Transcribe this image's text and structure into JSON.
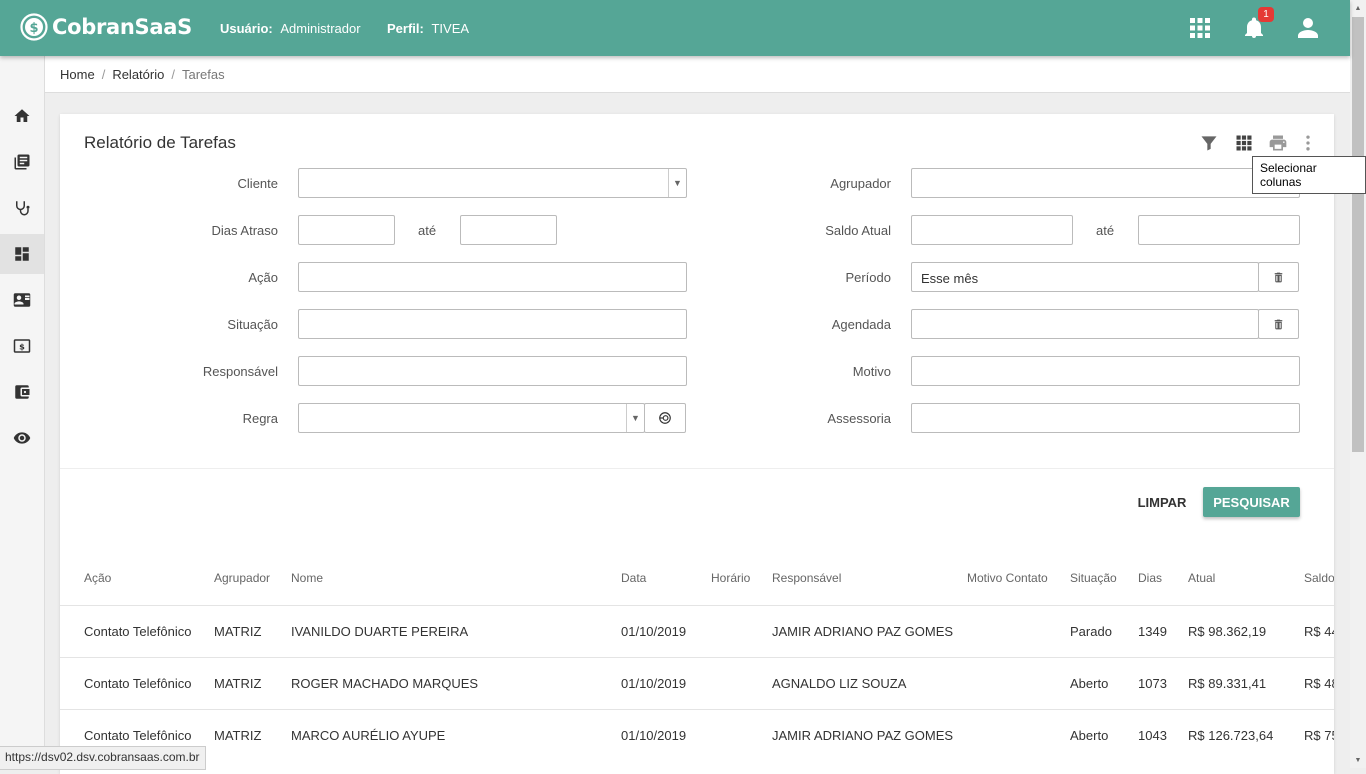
{
  "app": {
    "name": "CobranSaaS",
    "user_label": "Usuário:",
    "user_value": "Administrador",
    "profile_label": "Perfil:",
    "profile_value": "TIVEA",
    "notification_count": "1",
    "accent_color": "#55a696"
  },
  "sidebar": {
    "items": [
      {
        "icon": "home-icon"
      },
      {
        "icon": "book-icon"
      },
      {
        "icon": "stethoscope-icon"
      },
      {
        "icon": "dashboard-icon",
        "active": true
      },
      {
        "icon": "contact-card-icon"
      },
      {
        "icon": "money-icon"
      },
      {
        "icon": "wallet-icon"
      },
      {
        "icon": "eye-icon"
      }
    ]
  },
  "breadcrumb": {
    "home": "Home",
    "section": "Relatório",
    "current": "Tarefas",
    "separator": "/"
  },
  "page": {
    "title": "Relatório de Tarefas",
    "tooltip": "Selecionar colunas"
  },
  "filters": {
    "cliente": {
      "label": "Cliente",
      "value": ""
    },
    "dias_atraso": {
      "label": "Dias Atraso",
      "to_label": "até"
    },
    "acao": {
      "label": "Ação",
      "value": ""
    },
    "situacao": {
      "label": "Situação",
      "value": ""
    },
    "responsavel": {
      "label": "Responsável",
      "value": ""
    },
    "regra": {
      "label": "Regra",
      "value": ""
    },
    "agrupador": {
      "label": "Agrupador",
      "value": ""
    },
    "saldo_atual": {
      "label": "Saldo Atual",
      "to_label": "até"
    },
    "periodo": {
      "label": "Período",
      "value": "Esse mês"
    },
    "agendada": {
      "label": "Agendada",
      "value": ""
    },
    "motivo": {
      "label": "Motivo",
      "value": ""
    },
    "assessoria": {
      "label": "Assessoria",
      "value": ""
    }
  },
  "actions": {
    "clear": "LIMPAR",
    "search": "PESQUISAR"
  },
  "table": {
    "headers": [
      "Ação",
      "Agrupador",
      "Nome",
      "Data",
      "Horário",
      "Responsável",
      "Motivo Contato",
      "Situação",
      "Dias",
      "Atual",
      "Saldo"
    ],
    "rows": [
      [
        "Contato Telefônico",
        "MATRIZ",
        "IVANILDO DUARTE PEREIRA",
        "01/10/2019",
        "",
        "JAMIR ADRIANO PAZ GOMES",
        "",
        "Parado",
        "1349",
        "R$ 98.362,19",
        "R$ 44"
      ],
      [
        "Contato Telefônico",
        "MATRIZ",
        "ROGER MACHADO MARQUES",
        "01/10/2019",
        "",
        "AGNALDO LIZ SOUZA",
        "",
        "Aberto",
        "1073",
        "R$ 89.331,41",
        "R$ 48"
      ],
      [
        "Contato Telefônico",
        "MATRIZ",
        "MARCO AURÉLIO AYUPE",
        "01/10/2019",
        "",
        "JAMIR ADRIANO PAZ GOMES",
        "",
        "Aberto",
        "1043",
        "R$ 126.723,64",
        "R$ 75"
      ]
    ]
  },
  "status_url": "https://dsv02.dsv.cobransaas.com.br"
}
